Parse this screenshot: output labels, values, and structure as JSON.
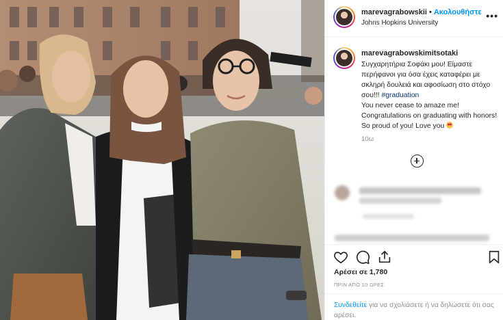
{
  "post": {
    "author": "marevagrabowskii",
    "follow_label": "Ακολουθήστε",
    "separator": "•",
    "location": "Johns Hopkins University",
    "more_label": "•••"
  },
  "caption": {
    "author": "marevagrabowskimitsotaki",
    "text_greek": "Συγχαρητήρια Σοφάκι μου! Είμαστε περήφανοι για όσα έχεις καταφέρει με σκληρή δουλειά και αφοσίωση στο στόχο σου!!! ",
    "hashtag": "#graduation",
    "text_english": "You never cease to amaze me! Congratulations on graduating with honors! So proud of you! Love you",
    "emoji": "heart-eyes-emoji",
    "time": "10ω"
  },
  "actions": {
    "like_icon": "heart-icon",
    "comment_icon": "comment-icon",
    "share_icon": "share-icon",
    "save_icon": "bookmark-icon",
    "likes_text": "Αρέσει σε 1,780",
    "timestamp": "ΠΡΙΝ ΑΠΟ 10 ΩΡΕΣ"
  },
  "login": {
    "link": "Συνδεθείτε",
    "text": " για να σχολιάσετε ή να δηλώσετε ότι σας αρέσει."
  },
  "colors": {
    "link_blue": "#0095f6",
    "hashtag_blue": "#00376b",
    "muted": "#8e8e8e",
    "text": "#262626"
  }
}
